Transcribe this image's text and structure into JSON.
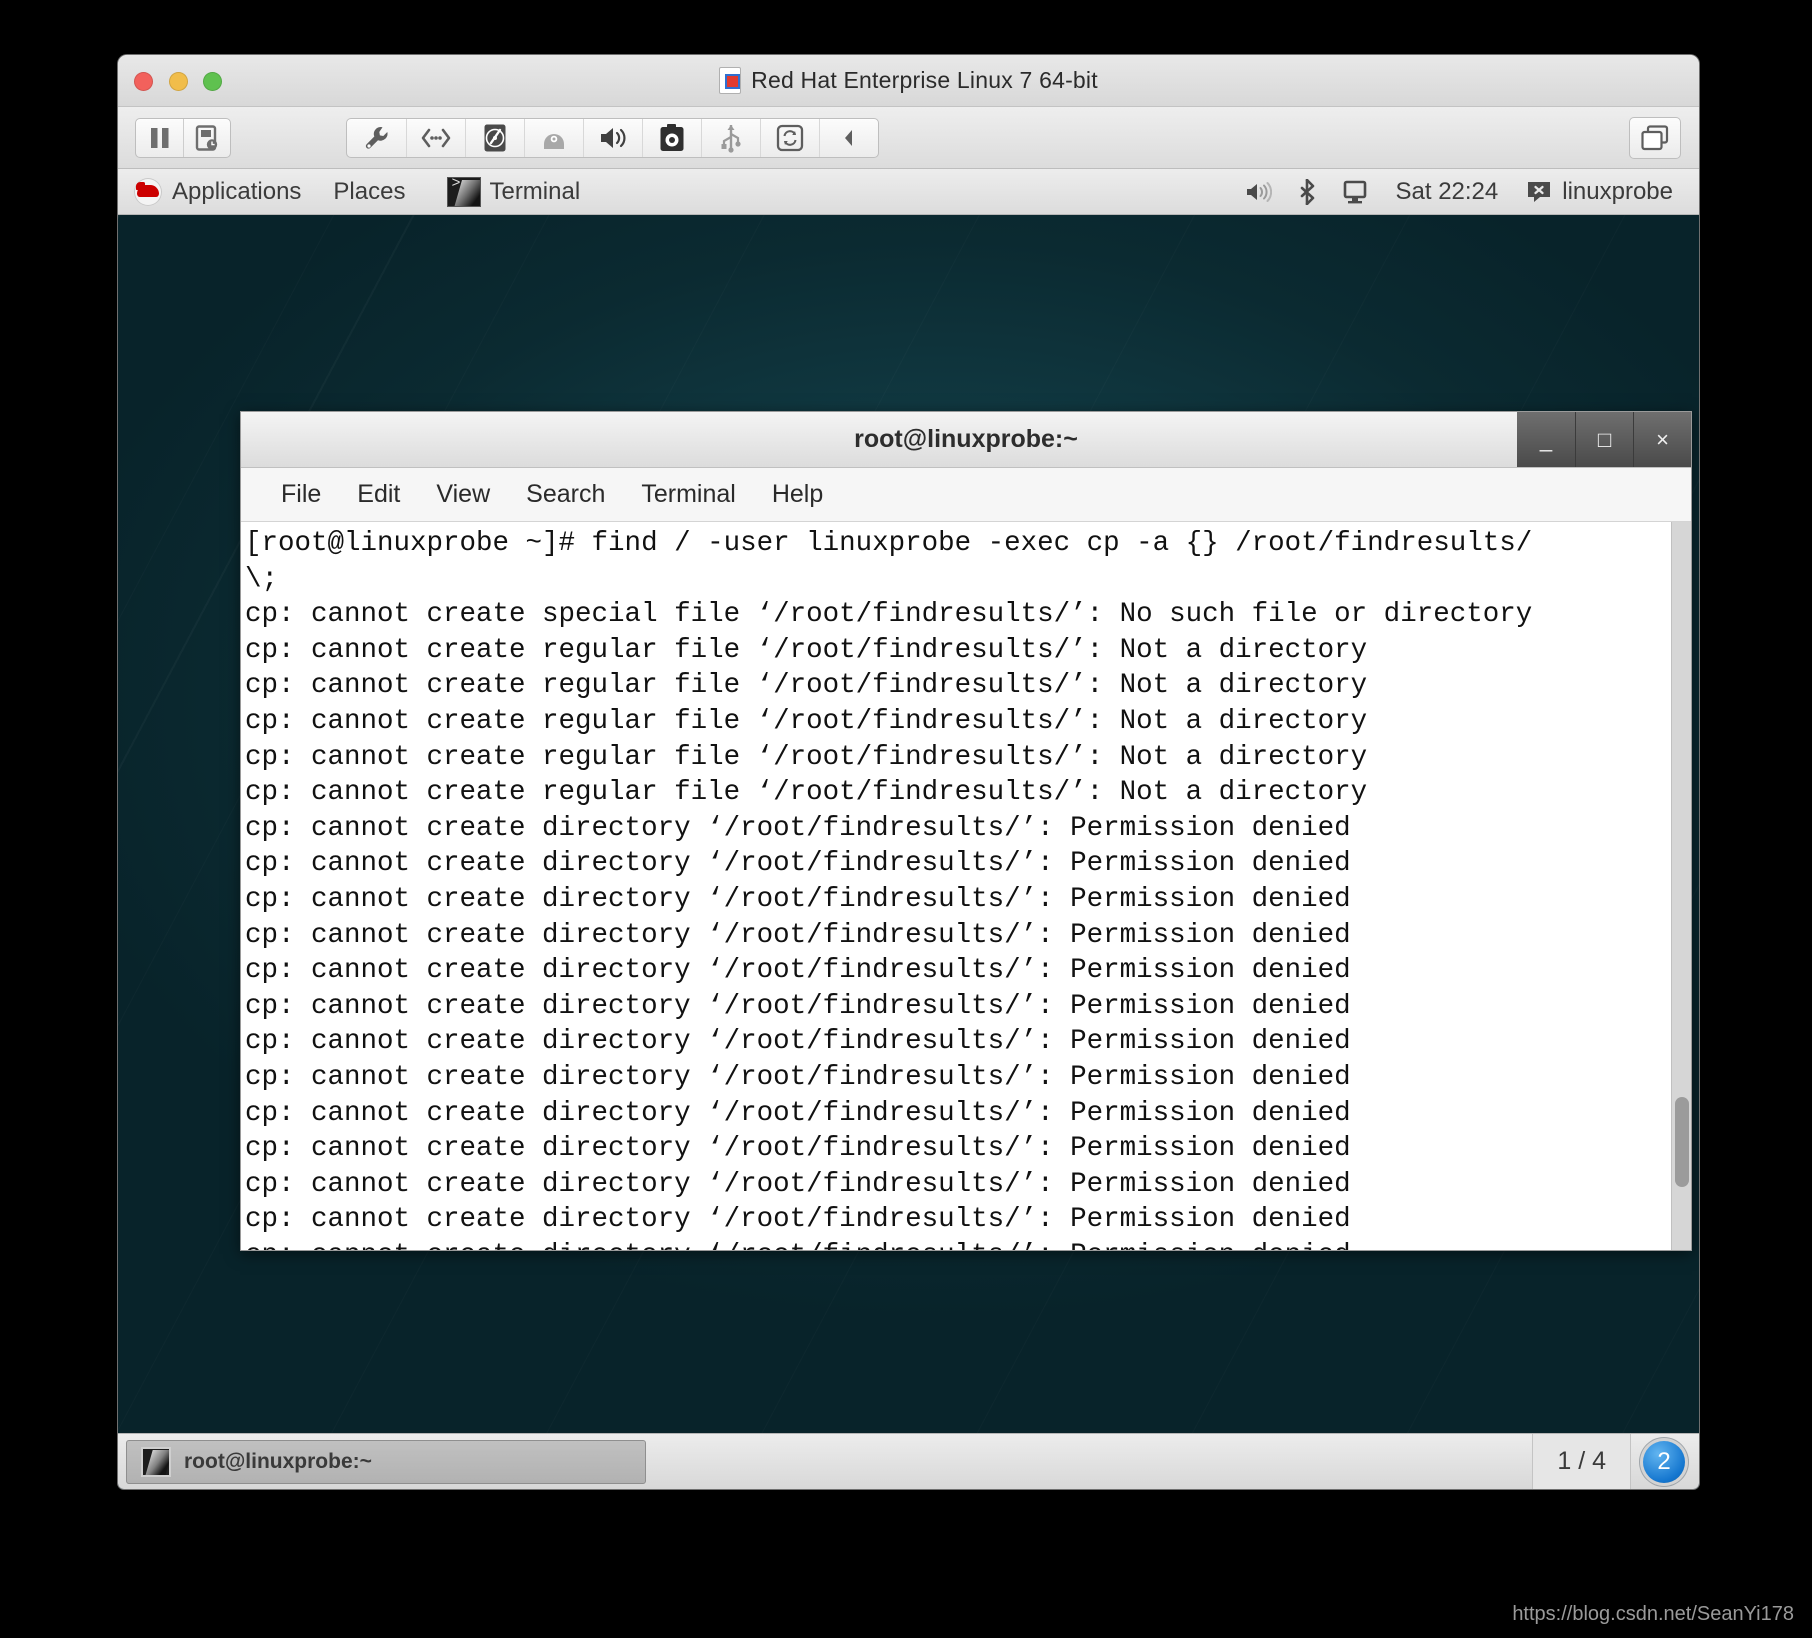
{
  "vm": {
    "title": "Red Hat Enterprise Linux 7 64-bit",
    "title_icon": "document-redhat-icon",
    "traffic_lights": [
      "close-button",
      "minimize-button",
      "zoom-button"
    ],
    "toolbar_left": [
      {
        "name": "pause-button",
        "icon": "pause-icon"
      },
      {
        "name": "snapshot-button",
        "icon": "snapshot-clock-icon"
      }
    ],
    "toolbar_devices": [
      {
        "name": "settings-button",
        "icon": "wrench-icon"
      },
      {
        "name": "network-button",
        "icon": "network-icon"
      },
      {
        "name": "harddisk-button",
        "icon": "hard-disk-icon"
      },
      {
        "name": "cd-button",
        "icon": "cd-drive-icon"
      },
      {
        "name": "sound-button",
        "icon": "speaker-icon"
      },
      {
        "name": "camera-button",
        "icon": "camera-icon"
      },
      {
        "name": "usb-button",
        "icon": "usb-icon"
      },
      {
        "name": "shared-folders-button",
        "icon": "sync-icon"
      },
      {
        "name": "more-button",
        "icon": "chevron-left-icon"
      }
    ],
    "toolbar_right": {
      "name": "unity-view-button",
      "icon": "windows-overlap-icon"
    }
  },
  "panel": {
    "applications": "Applications",
    "places": "Places",
    "window_tab": "Terminal",
    "clock": "Sat 22:24",
    "user": "linuxprobe",
    "tray": [
      {
        "name": "volume-tray-icon",
        "icon": "speaker-icon"
      },
      {
        "name": "bluetooth-tray-icon",
        "icon": "bluetooth-icon"
      },
      {
        "name": "display-tray-icon",
        "icon": "monitor-icon"
      }
    ]
  },
  "terminal": {
    "title": "root@linuxprobe:~",
    "window_buttons": [
      {
        "name": "terminal-minimize-button",
        "glyph": "_"
      },
      {
        "name": "terminal-maximize-button",
        "glyph": "□"
      },
      {
        "name": "terminal-close-button",
        "glyph": "×"
      }
    ],
    "menu": [
      "File",
      "Edit",
      "View",
      "Search",
      "Terminal",
      "Help"
    ],
    "content": "[root@linuxprobe ~]# find / -user linuxprobe -exec cp -a {} /root/findresults/\n\\;\ncp: cannot create special file ‘/root/findresults/’: No such file or directory\ncp: cannot create regular file ‘/root/findresults/’: Not a directory\ncp: cannot create regular file ‘/root/findresults/’: Not a directory\ncp: cannot create regular file ‘/root/findresults/’: Not a directory\ncp: cannot create regular file ‘/root/findresults/’: Not a directory\ncp: cannot create regular file ‘/root/findresults/’: Not a directory\ncp: cannot create directory ‘/root/findresults/’: Permission denied\ncp: cannot create directory ‘/root/findresults/’: Permission denied\ncp: cannot create directory ‘/root/findresults/’: Permission denied\ncp: cannot create directory ‘/root/findresults/’: Permission denied\ncp: cannot create directory ‘/root/findresults/’: Permission denied\ncp: cannot create directory ‘/root/findresults/’: Permission denied\ncp: cannot create directory ‘/root/findresults/’: Permission denied\ncp: cannot create directory ‘/root/findresults/’: Permission denied\ncp: cannot create directory ‘/root/findresults/’: Permission denied\ncp: cannot create directory ‘/root/findresults/’: Permission denied\ncp: cannot create directory ‘/root/findresults/’: Permission denied\ncp: cannot create directory ‘/root/findresults/’: Permission denied\ncp: cannot create directory ‘/root/findresults/’: Permission denied\ncp: cannot create directory ‘/root/findresults/’: Permission denied\ncp: cannot create directory ‘/root/findresults/’: Permission denied\ncp: cannot create directory ‘/root/findresults/’: Permission denied"
  },
  "taskbar": {
    "task_label": "root@linuxprobe:~",
    "workspace": "1 / 4",
    "notification_count": "2"
  },
  "watermark": "https://blog.csdn.net/SeanYi178"
}
